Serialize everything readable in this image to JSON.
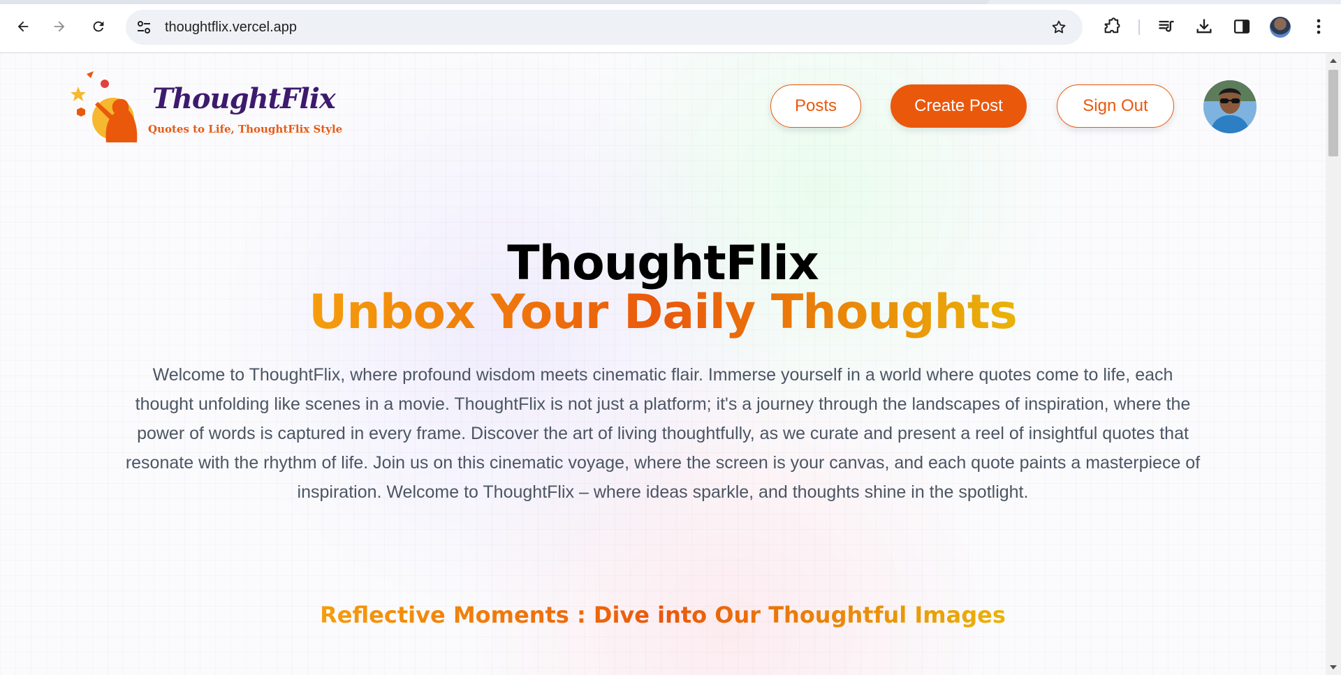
{
  "browser": {
    "url": "thoughtflix.vercel.app",
    "icons": {
      "back": "arrow-left-icon",
      "forward": "arrow-right-icon",
      "reload": "reload-icon",
      "site_info": "tune-icon",
      "bookmark": "star-icon",
      "extensions": "puzzle-icon",
      "media": "playlist-icon",
      "downloads": "download-icon",
      "side_panel": "side-panel-icon",
      "menu": "kebab-menu-icon"
    }
  },
  "site": {
    "logo": {
      "brand": "ThoughtFlix",
      "tagline": "Quotes to Life, ThoughtFlix Style"
    },
    "nav": {
      "posts_label": "Posts",
      "create_label": "Create Post",
      "signout_label": "Sign Out"
    },
    "colors": {
      "accent": "#ea580c",
      "brand_purple": "#3d1a6e",
      "gradient": [
        "#f59e0b",
        "#ea580c",
        "#eab308"
      ]
    }
  },
  "hero": {
    "title": "ThoughtFlix",
    "subtitle": "Unbox Your Daily Thoughts",
    "description": "Welcome to ThoughtFlix, where profound wisdom meets cinematic flair. Immerse yourself in a world where quotes come to life, each thought unfolding like scenes in a movie. ThoughtFlix is not just a platform; it's a journey through the landscapes of inspiration, where the power of words is captured in every frame. Discover the art of living thoughtfully, as we curate and present a reel of insightful quotes that resonate with the rhythm of life. Join us on this cinematic voyage, where the screen is your canvas, and each quote paints a masterpiece of inspiration. Welcome to ThoughtFlix – where ideas sparkle, and thoughts shine in the spotlight."
  },
  "gallery": {
    "heading": "Reflective Moments : Dive into Our Thoughtful Images"
  }
}
